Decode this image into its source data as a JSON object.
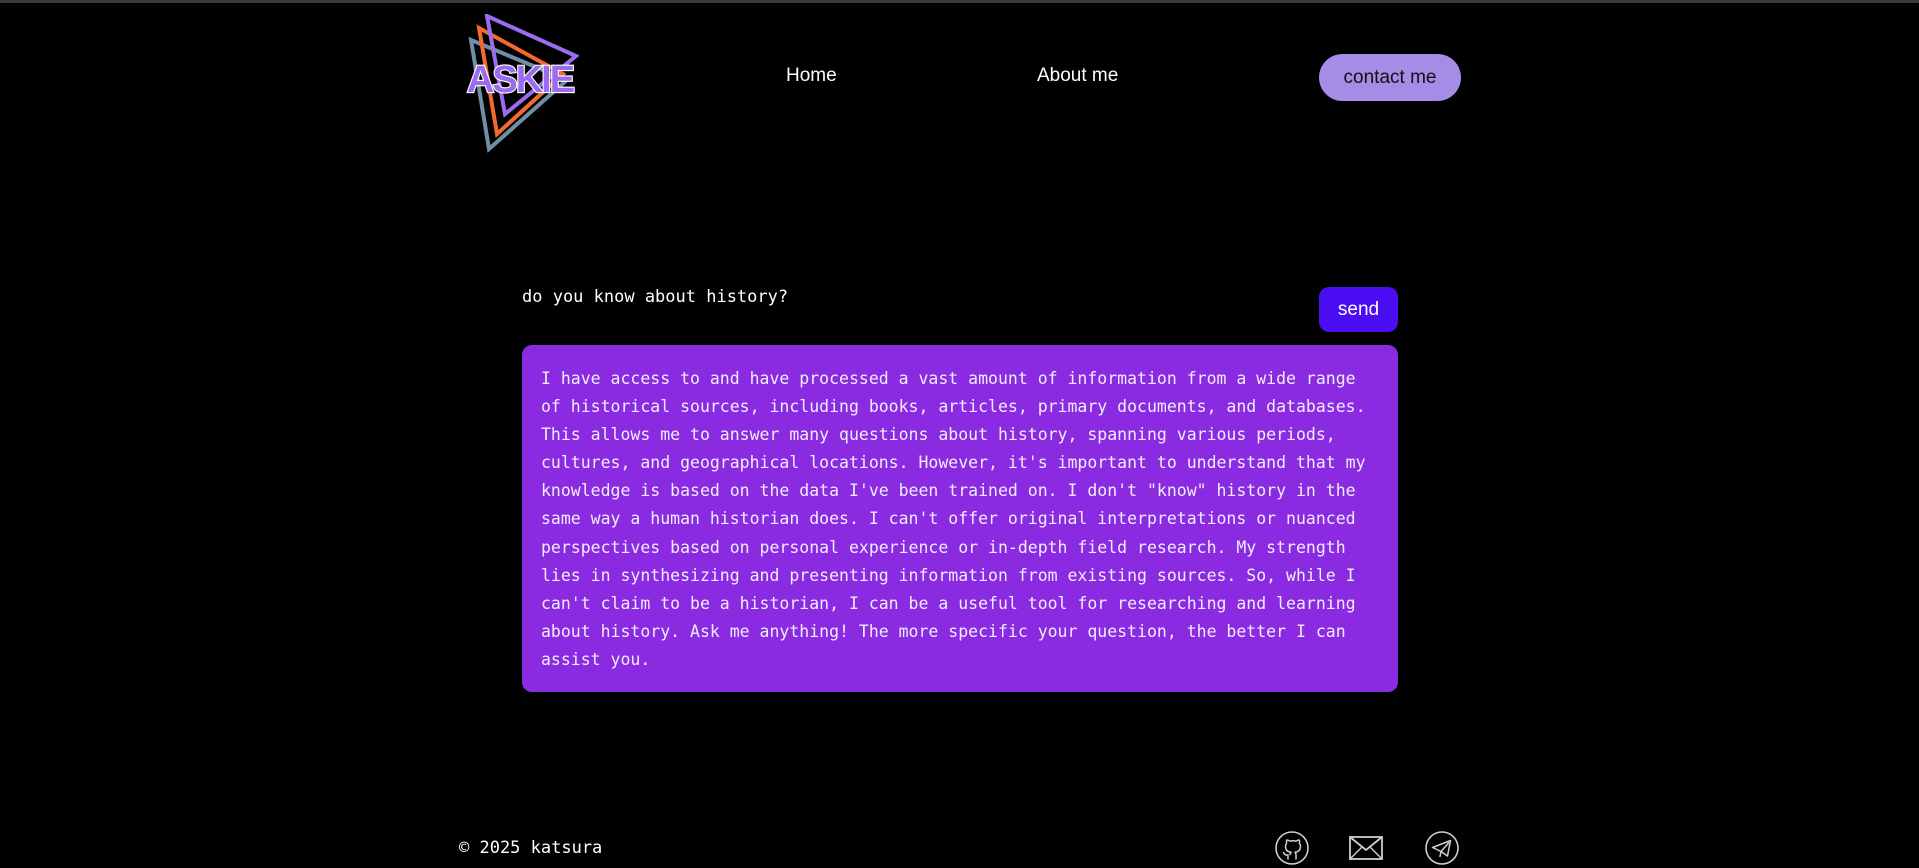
{
  "header": {
    "logo_text": "ASKIE",
    "nav": {
      "home_label": "Home",
      "about_label": "About me"
    },
    "contact_label": "contact me"
  },
  "chat": {
    "question": "do you know about history?",
    "send_label": "send",
    "answer": "I have access to and have processed a vast amount of information from a wide range of historical sources, including books, articles, primary documents, and databases. This allows me to answer many questions about history, spanning various periods, cultures, and geographical locations. However, it's important to understand that my knowledge is based on the data I've been trained on. I don't \"know\" history in the same way a human historian does. I can't offer original interpretations or nuanced perspectives based on personal experience or in-depth field research. My strength lies in synthesizing and presenting information from existing sources. So, while I can't claim to be a historian, I can be a useful tool for researching and learning about history. Ask me anything! The more specific your question, the better I can assist you."
  },
  "footer": {
    "copyright": "© 2025 katsura",
    "social": [
      "github-icon",
      "mail-icon",
      "telegram-icon"
    ]
  },
  "colors": {
    "background": "#000000",
    "contact_button": "#a58ce6",
    "send_button": "#4a0df2",
    "answer_box": "#8a2be2",
    "logo_purple": "#9b6cf0",
    "logo_orange": "#f26a2e",
    "logo_steel": "#6f8fa6"
  }
}
